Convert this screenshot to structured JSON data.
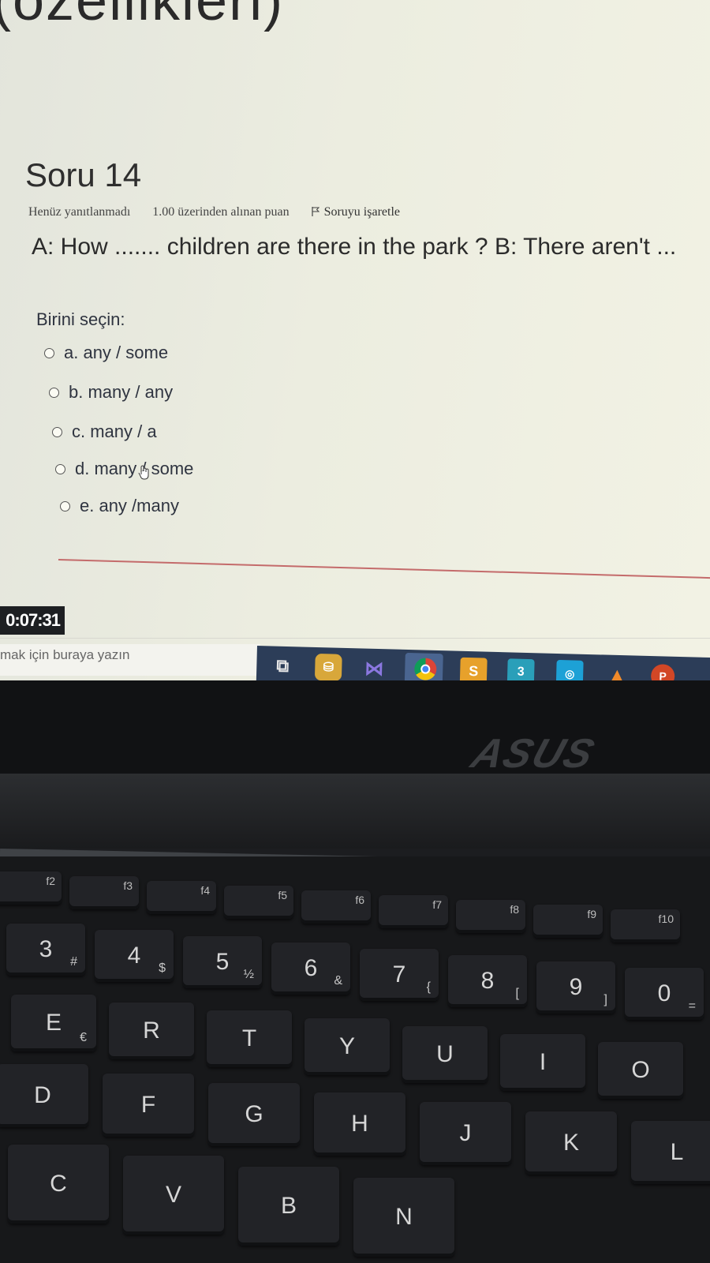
{
  "quiz": {
    "cut_heading": "(özellikleri)",
    "question_title": "Soru 14",
    "status": "Henüz yanıtlanmadı",
    "points": "1.00 üzerinden alınan puan",
    "flag_label": "Soruyu işaretle",
    "question_text": "A: How ....... children are there in the park ? B: There aren't ...",
    "choose_label": "Birini seçin:",
    "options": [
      {
        "label": "a. any / some"
      },
      {
        "label": "b. many / any"
      },
      {
        "label": "c. many / a"
      },
      {
        "label": "d. many / some"
      },
      {
        "label": "e. any /many"
      }
    ],
    "timer": "0:07:31"
  },
  "taskbar": {
    "search_placeholder": "mak için buraya yazın",
    "icons": [
      "task-view-icon",
      "database-icon",
      "visual-studio-icon",
      "chrome-icon",
      "sublime-text-icon",
      "3ds-max-icon",
      "camera-app-icon",
      "matlab-icon",
      "powerpoint-icon"
    ],
    "sublime_letter": "S",
    "app3_letter": "3",
    "app6_glyph": "◎",
    "ppt_letter": "P"
  },
  "laptop": {
    "brand": "ASUS",
    "fn_keys": [
      "f2",
      "f3",
      "f4",
      "f5",
      "f6",
      "f7",
      "f8",
      "f9",
      "f10"
    ],
    "number_keys": [
      {
        "main": "3",
        "sub": "#"
      },
      {
        "main": "4",
        "sub": "$"
      },
      {
        "main": "5",
        "sub": "½"
      },
      {
        "main": "6",
        "sub": "&"
      },
      {
        "main": "7",
        "sub": "{"
      },
      {
        "main": "8",
        "sub": "["
      },
      {
        "main": "9",
        "sub": "]"
      },
      {
        "main": "0",
        "sub": "="
      }
    ],
    "row_qwerty": [
      "E",
      "R",
      "T",
      "Y",
      "U",
      "I",
      "O"
    ],
    "row_asdf": [
      "D",
      "F",
      "G",
      "H",
      "J",
      "K",
      "L"
    ],
    "row_zxcv": [
      "C",
      "V",
      "B",
      "N"
    ],
    "e_sub": "€"
  }
}
